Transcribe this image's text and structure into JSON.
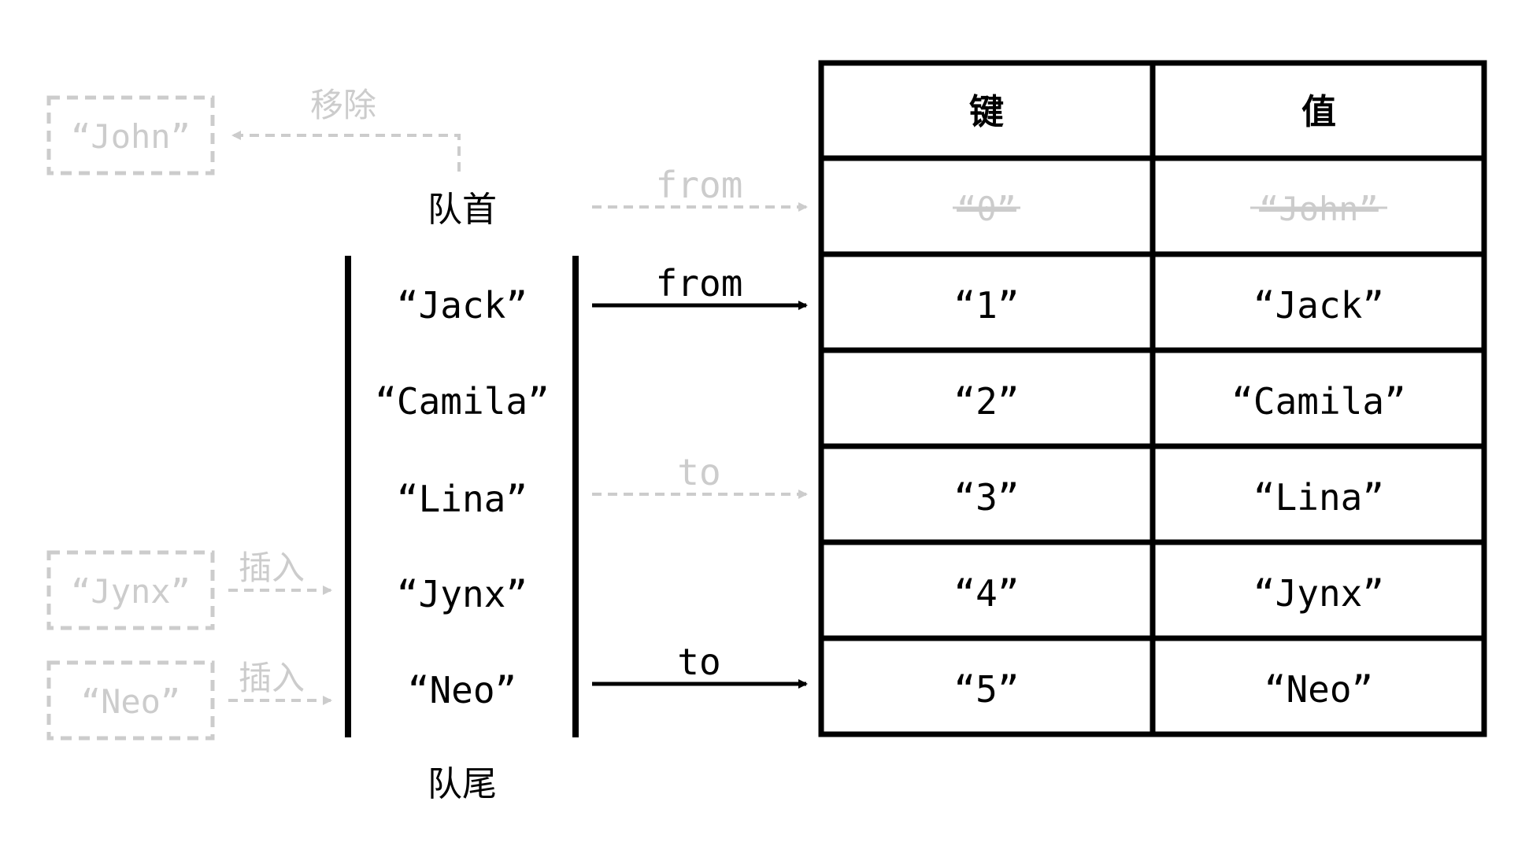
{
  "colors": {
    "ink": "#000000",
    "faded": "#cccccc"
  },
  "removed": {
    "box_label": "“John”",
    "arrow_label": "移除"
  },
  "queue": {
    "head_label": "队首",
    "tail_label": "队尾",
    "items": [
      "“Jack”",
      "“Camila”",
      "“Lina”",
      "“Jynx”",
      "“Neo”"
    ]
  },
  "inserted": [
    {
      "box_label": "“Jynx”",
      "arrow_label": "插入"
    },
    {
      "box_label": "“Neo”",
      "arrow_label": "插入"
    }
  ],
  "pointers": {
    "from_old": "from",
    "from_new": "from",
    "to_old": "to",
    "to_new": "to"
  },
  "table": {
    "headers": [
      "键",
      "值"
    ],
    "deleted_row": {
      "key": "“0”",
      "value": "“John”"
    },
    "rows": [
      {
        "key": "“1”",
        "value": "“Jack”"
      },
      {
        "key": "“2”",
        "value": "“Camila”"
      },
      {
        "key": "“3”",
        "value": "“Lina”"
      },
      {
        "key": "“4”",
        "value": "“Jynx”"
      },
      {
        "key": "“5”",
        "value": "“Neo”"
      }
    ]
  }
}
